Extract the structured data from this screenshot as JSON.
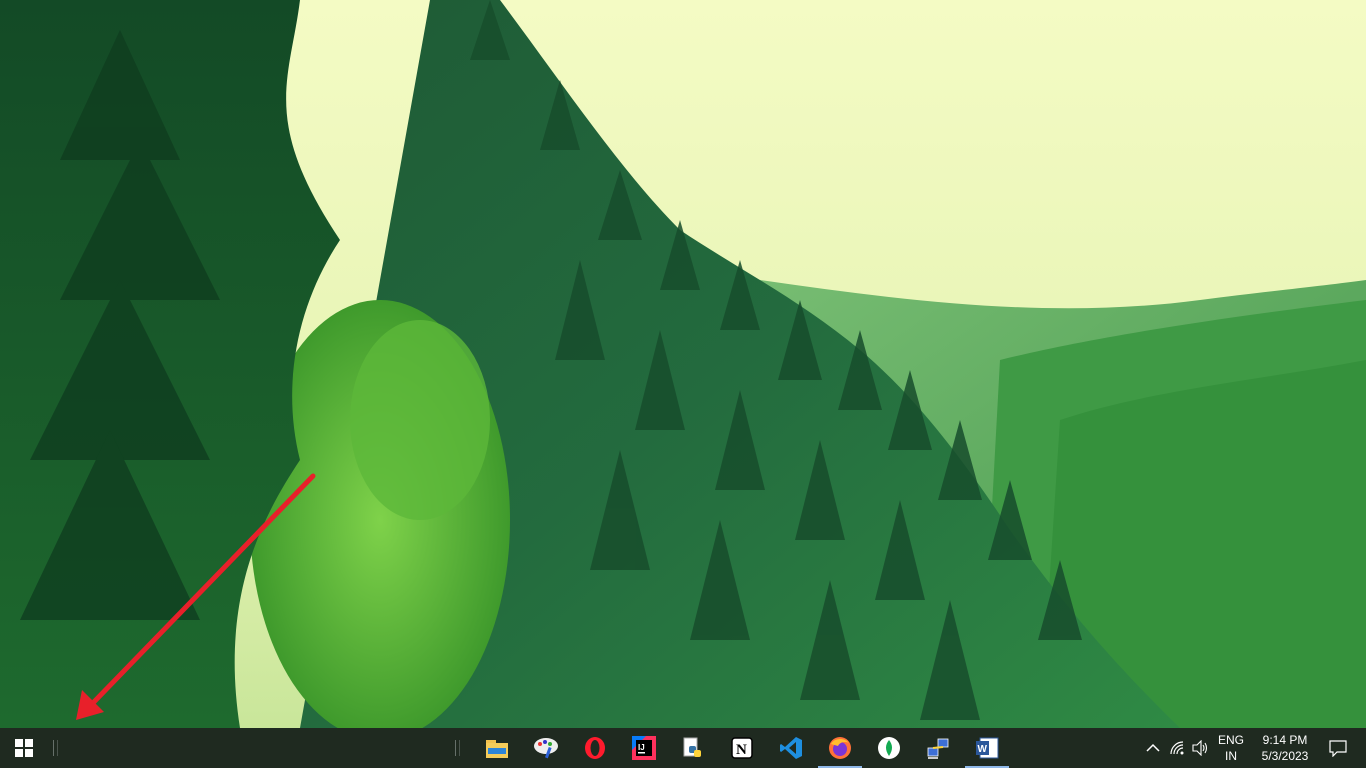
{
  "desktop": {
    "wallpaper": "misty-forest-mountain-valley",
    "annotation": {
      "type": "arrow",
      "color": "#e8202a",
      "points_to": "start-button"
    }
  },
  "taskbar": {
    "background": "#1f2a20",
    "start_icon": "windows-logo-icon",
    "pinned_apps": [
      {
        "name": "File Explorer",
        "icon": "file-explorer-icon",
        "running": false
      },
      {
        "name": "Paint",
        "icon": "paint-icon",
        "running": false
      },
      {
        "name": "Opera",
        "icon": "opera-icon",
        "running": false
      },
      {
        "name": "IntelliJ IDEA",
        "icon": "intellij-icon",
        "running": false
      },
      {
        "name": "Python",
        "icon": "python-icon",
        "running": false
      },
      {
        "name": "Notion",
        "icon": "notion-icon",
        "running": false
      },
      {
        "name": "Visual Studio Code",
        "icon": "vscode-icon",
        "running": false
      },
      {
        "name": "Firefox",
        "icon": "firefox-icon",
        "running": true
      },
      {
        "name": "MongoDB Compass",
        "icon": "mongodb-icon",
        "running": false
      },
      {
        "name": "Network Tool",
        "icon": "network-tool-icon",
        "running": false
      },
      {
        "name": "Microsoft Word",
        "icon": "word-icon",
        "running": true
      }
    ],
    "tray": {
      "show_hidden_icon": "chevron-up-icon",
      "network_icon": "wifi-icon",
      "volume_icon": "speaker-icon",
      "language_line1": "ENG",
      "language_line2": "IN",
      "time": "9:14 PM",
      "date": "5/3/2023",
      "notification_icon": "action-center-icon"
    }
  }
}
